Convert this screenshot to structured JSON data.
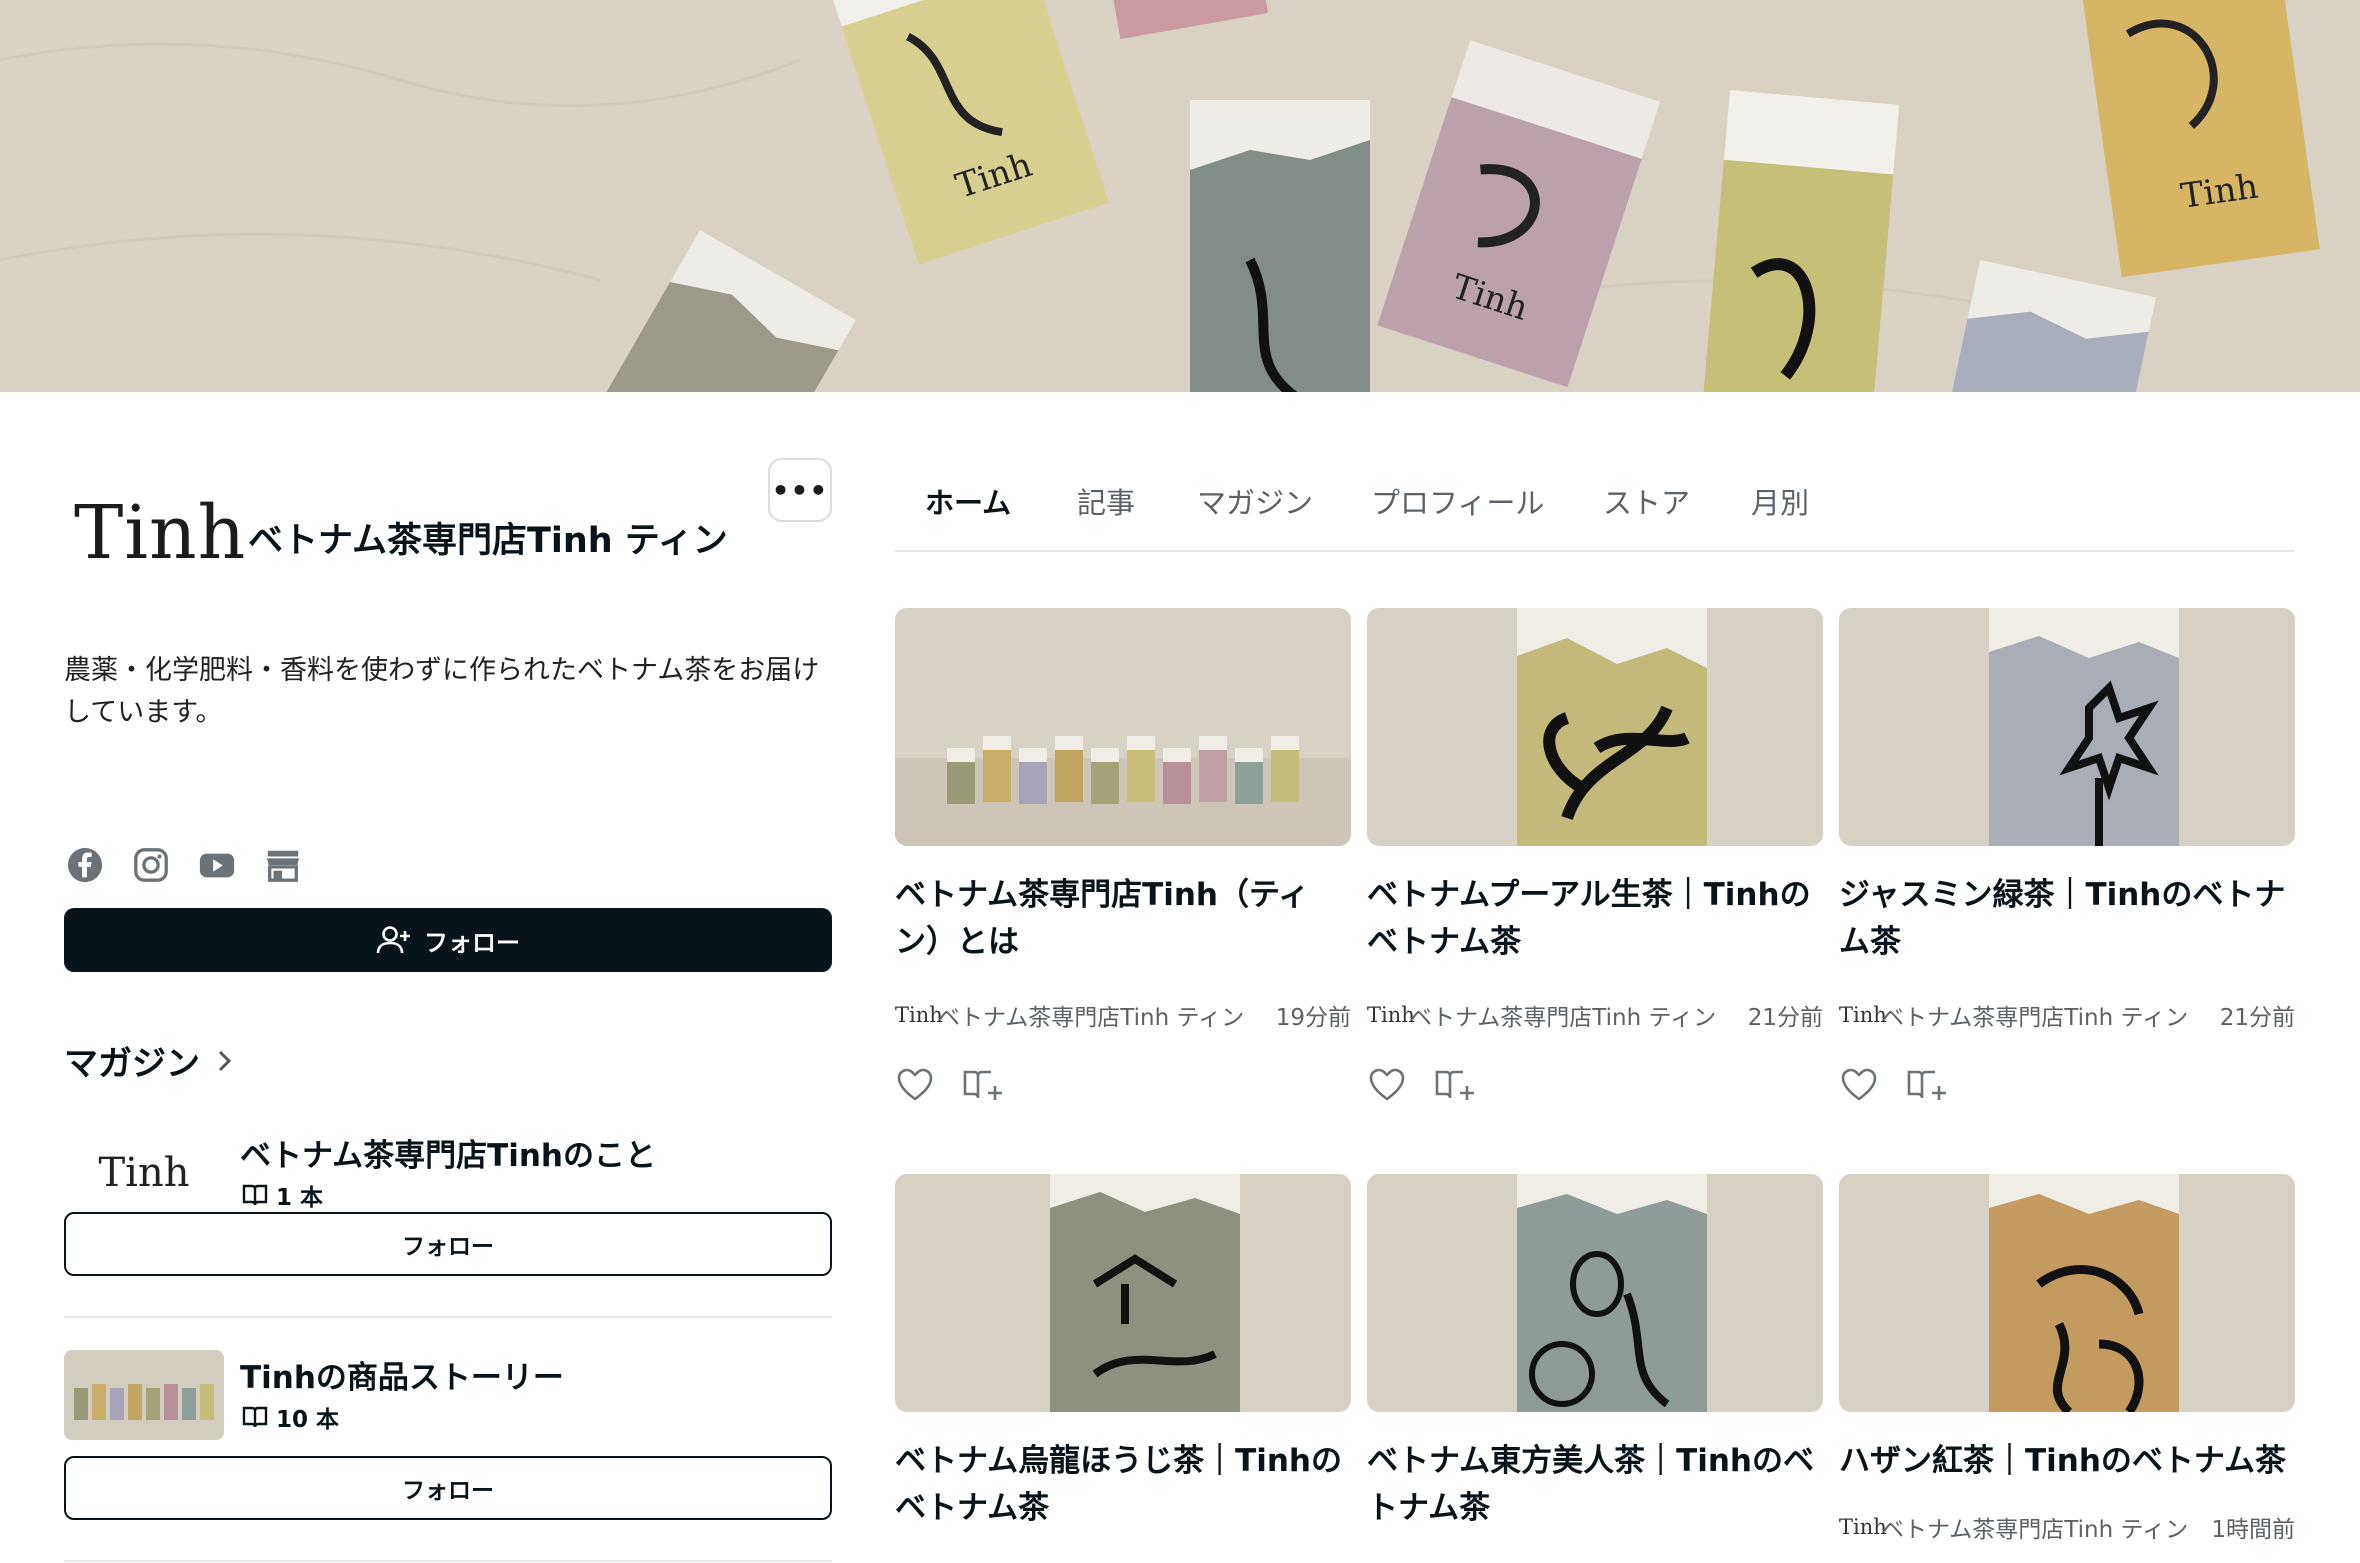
{
  "creator": {
    "logo_text": "Tinh",
    "name": "ベトナム茶専門店Tinh ティン",
    "bio": "農薬・化学肥料・香料を使わずに作られたベトナム茶をお届けしています。",
    "more_label": "•••",
    "follow_label": "フォロー",
    "social_icons": [
      "facebook-icon",
      "instagram-icon",
      "youtube-icon",
      "store-icon"
    ]
  },
  "magazines": {
    "heading": "マガジン",
    "items": [
      {
        "title": "ベトナム茶専門店Tinhのこと",
        "count": "1 本",
        "follow": "フォロー",
        "thumb_text": "Tinh"
      },
      {
        "title": "Tinhの商品ストーリー",
        "count": "10 本",
        "follow": "フォロー"
      }
    ]
  },
  "tabs": [
    "ホーム",
    "記事",
    "マガジン",
    "プロフィール",
    "ストア",
    "月別"
  ],
  "active_tab": "ホーム",
  "articles": [
    {
      "title": "ベトナム茶専門店Tinh（ティン）とは",
      "author": "ベトナム茶専門店Tinh ティン",
      "time": "19分前",
      "logo": "Tinh",
      "color": "#d9d3c7"
    },
    {
      "title": "ベトナムプーアル生茶｜Tinhのベトナム茶",
      "author": "ベトナム茶専門店Tinh ティン",
      "time": "21分前",
      "logo": "Tinh",
      "color": "#c3b97b"
    },
    {
      "title": "ジャスミン緑茶｜Tinhのベトナム茶",
      "author": "ベトナム茶専門店Tinh ティン",
      "time": "21分前",
      "logo": "Tinh",
      "color": "#a9adb6"
    },
    {
      "title": "ベトナム烏龍ほうじ茶｜Tinhのベトナム茶",
      "author": "",
      "time": "",
      "logo": "",
      "color": "#8d917f"
    },
    {
      "title": "ベトナム東方美人茶｜Tinhのベトナム茶",
      "author": "",
      "time": "",
      "logo": "",
      "color": "#8f9b98"
    },
    {
      "title": "ハザン紅茶｜Tinhのベトナム茶",
      "author": "ベトナム茶専門店Tinh ティン",
      "time": "1時間前",
      "logo": "Tinh",
      "color": "#c39a60"
    }
  ]
}
